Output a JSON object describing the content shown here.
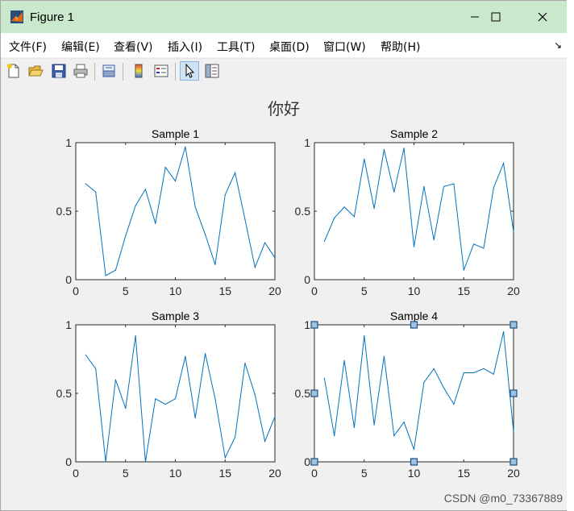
{
  "window": {
    "title": "Figure 1",
    "icon": "matlab-icon",
    "buttons": [
      "minimize-icon",
      "maximize-icon",
      "close-icon"
    ]
  },
  "menu": {
    "items": [
      "文件(F)",
      "编辑(E)",
      "查看(V)",
      "插入(I)",
      "工具(T)",
      "桌面(D)",
      "窗口(W)",
      "帮助(H)"
    ],
    "dock_glyph": "↘"
  },
  "toolbar": {
    "icons": [
      "new-figure-icon",
      "open-file-icon",
      "save-icon",
      "print-icon",
      "print-preview-icon",
      "colorbar-icon",
      "legend-icon",
      "select-pointer-icon",
      "property-editor-icon"
    ]
  },
  "figure": {
    "sup_title": "你好",
    "line_color": "#0072bd"
  },
  "chart_data": [
    {
      "type": "line",
      "title": "Sample 1",
      "xlim": [
        0,
        20
      ],
      "ylim": [
        0,
        1
      ],
      "xticks": [
        "0",
        "5",
        "10",
        "15",
        "20"
      ],
      "yticks": [
        "0",
        "0.5",
        "1"
      ],
      "x": [
        1,
        2,
        3,
        4,
        5,
        6,
        7,
        8,
        9,
        10,
        11,
        12,
        13,
        14,
        15,
        16,
        17,
        18,
        19,
        20
      ],
      "values": [
        0.7,
        0.64,
        0.03,
        0.07,
        0.32,
        0.54,
        0.66,
        0.41,
        0.82,
        0.72,
        0.97,
        0.53,
        0.33,
        0.11,
        0.62,
        0.78,
        0.44,
        0.09,
        0.27,
        0.16
      ],
      "selected": false
    },
    {
      "type": "line",
      "title": "Sample 2",
      "xlim": [
        0,
        20
      ],
      "ylim": [
        0,
        1
      ],
      "xticks": [
        "0",
        "5",
        "10",
        "15",
        "20"
      ],
      "yticks": [
        "0",
        "0.5",
        "1"
      ],
      "x": [
        1,
        2,
        3,
        4,
        5,
        6,
        7,
        8,
        9,
        10,
        11,
        12,
        13,
        14,
        15,
        16,
        17,
        18,
        19,
        20
      ],
      "values": [
        0.28,
        0.45,
        0.53,
        0.46,
        0.88,
        0.52,
        0.95,
        0.64,
        0.96,
        0.24,
        0.68,
        0.29,
        0.68,
        0.7,
        0.07,
        0.26,
        0.23,
        0.67,
        0.85,
        0.35
      ],
      "selected": false
    },
    {
      "type": "line",
      "title": "Sample 3",
      "xlim": [
        0,
        20
      ],
      "ylim": [
        0,
        1
      ],
      "xticks": [
        "0",
        "5",
        "10",
        "15",
        "20"
      ],
      "yticks": [
        "0",
        "0.5",
        "1"
      ],
      "x": [
        1,
        2,
        3,
        4,
        5,
        6,
        7,
        8,
        9,
        10,
        11,
        12,
        13,
        14,
        15,
        16,
        17,
        18,
        19,
        20
      ],
      "values": [
        0.78,
        0.68,
        0.0,
        0.6,
        0.39,
        0.92,
        0.0,
        0.46,
        0.42,
        0.46,
        0.77,
        0.32,
        0.79,
        0.46,
        0.03,
        0.18,
        0.72,
        0.49,
        0.15,
        0.33
      ],
      "selected": false
    },
    {
      "type": "line",
      "title": "Sample 4",
      "xlim": [
        0,
        20
      ],
      "ylim": [
        0,
        1
      ],
      "xticks": [
        "0",
        "5",
        "10",
        "15",
        "20"
      ],
      "yticks": [
        "0",
        "0.5",
        "1"
      ],
      "x": [
        1,
        2,
        3,
        4,
        5,
        6,
        7,
        8,
        9,
        10,
        11,
        12,
        13,
        14,
        15,
        16,
        17,
        18,
        19,
        20
      ],
      "values": [
        0.61,
        0.19,
        0.74,
        0.25,
        0.92,
        0.27,
        0.77,
        0.19,
        0.29,
        0.09,
        0.58,
        0.68,
        0.54,
        0.42,
        0.65,
        0.65,
        0.68,
        0.64,
        0.95,
        0.22
      ],
      "selected": true
    }
  ],
  "watermark": "CSDN @m0_73367889"
}
